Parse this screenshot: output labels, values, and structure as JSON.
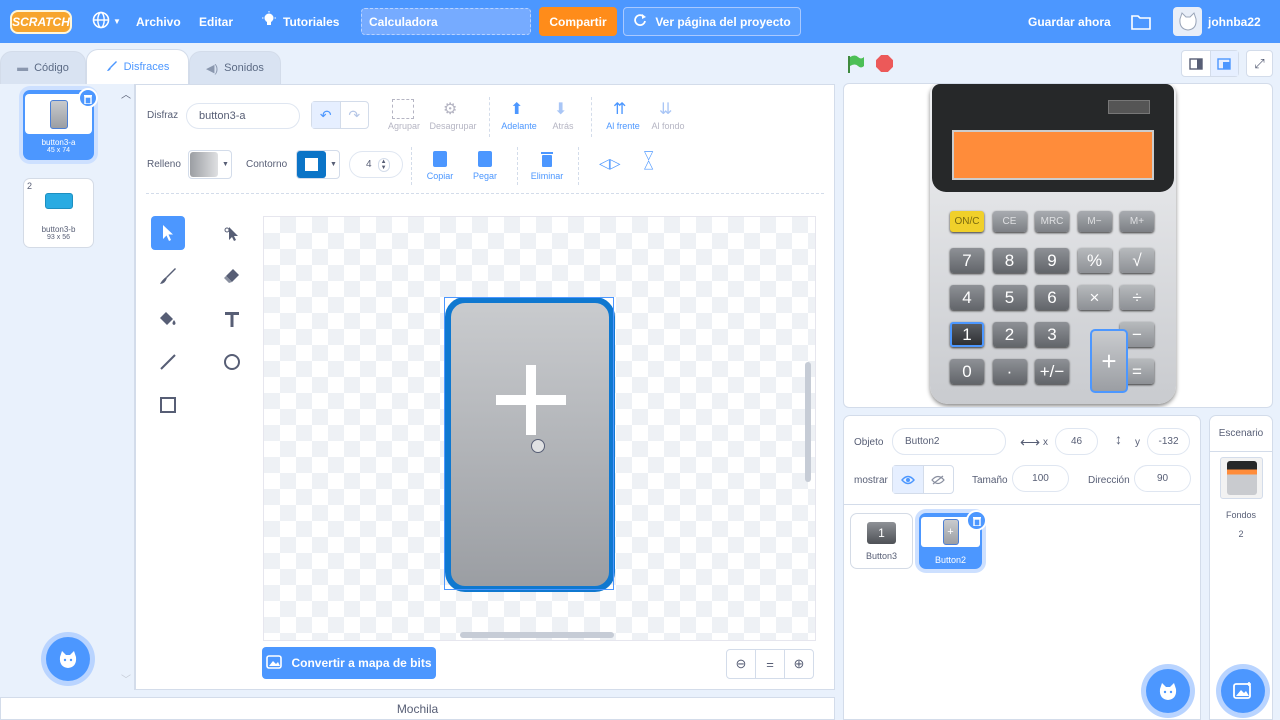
{
  "menubar": {
    "logo": "SCRATCH",
    "file": "Archivo",
    "edit": "Editar",
    "tutorials": "Tutoriales",
    "project_title": "Calculadora",
    "share": "Compartir",
    "see_project": "Ver página del proyecto",
    "save_now": "Guardar ahora",
    "username": "johnba22"
  },
  "tabs": {
    "code": "Código",
    "costumes": "Disfraces",
    "sounds": "Sonidos"
  },
  "costumes": [
    {
      "index": "1",
      "name": "button3-a",
      "size": "45 x 74"
    },
    {
      "index": "2",
      "name": "button3-b",
      "size": "93 x 56"
    }
  ],
  "paint": {
    "costume_label": "Disfraz",
    "costume_name": "button3-a",
    "fill_label": "Relleno",
    "outline_label": "Contorno",
    "outline_width": "4",
    "group": "Agrupar",
    "ungroup": "Desagrupar",
    "forward": "Adelante",
    "backward": "Atrás",
    "front": "Al frente",
    "back": "Al fondo",
    "copy": "Copiar",
    "paste": "Pegar",
    "delete": "Eliminar",
    "convert_bitmap": "Convertir a mapa de bits",
    "zoom_reset": "="
  },
  "backpack": "Mochila",
  "sprite": {
    "sprite_label": "Objeto",
    "name": "Button2",
    "x_label": "x",
    "x": "46",
    "y_label": "y",
    "y": "-132",
    "show_label": "mostrar",
    "size_label": "Tamaño",
    "size": "100",
    "direction_label": "Dirección",
    "direction": "90"
  },
  "sprites": [
    {
      "name": "Button3",
      "glyph": "1"
    },
    {
      "name": "Button2",
      "glyph": "+"
    }
  ],
  "stage_panel": {
    "title": "Escenario",
    "backdrops_label": "Fondos",
    "backdrops_count": "2"
  },
  "calculator": {
    "row1": [
      "ON/C",
      "CE",
      "MRC",
      "M−",
      "M+"
    ],
    "row2": [
      "7",
      "8",
      "9",
      "%",
      "√"
    ],
    "row3": [
      "4",
      "5",
      "6",
      "×",
      "÷"
    ],
    "row4": [
      "1",
      "2",
      "3",
      "",
      "−"
    ],
    "row5": [
      "0",
      "·",
      "+/−",
      "",
      "="
    ]
  },
  "colors": {
    "accent": "#4c97ff",
    "share": "#ff8c1a",
    "display": "#ff8c3a"
  }
}
